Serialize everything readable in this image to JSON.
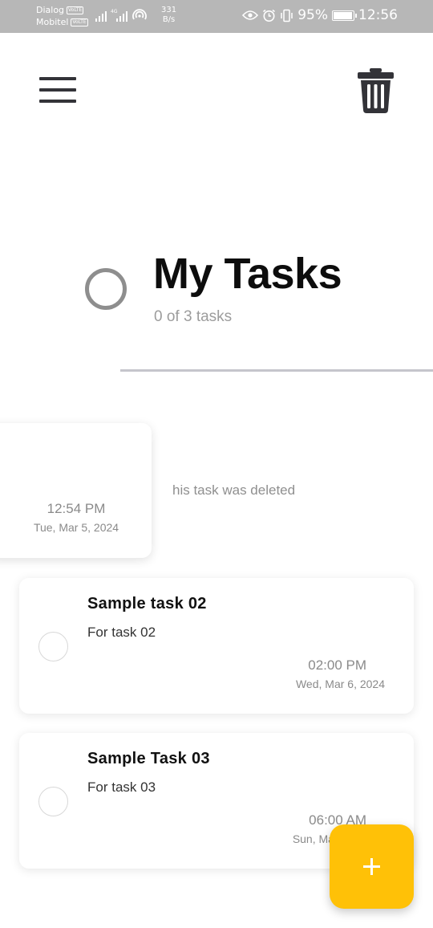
{
  "status_bar": {
    "carrier_1": "Dialog",
    "carrier_2": "Mobitel",
    "volte": "VoLTE",
    "net_speed_value": "331",
    "net_speed_unit": "B/s",
    "battery": "95%",
    "battery_level": 0.95,
    "time": "12:56"
  },
  "header": {
    "menu_icon": "hamburger-menu-icon",
    "delete_icon": "trash-icon",
    "title": "My Tasks",
    "task_count": "0 of 3 tasks"
  },
  "deleted_task": {
    "message": "his task was deleted",
    "time": "12:54 PM",
    "date": "Tue, Mar 5, 2024"
  },
  "tasks": [
    {
      "title": "Sample task 02",
      "description": "For task 02",
      "time": "02:00 PM",
      "date": "Wed, Mar 6, 2024"
    },
    {
      "title": "Sample Task 03",
      "description": "For task 03",
      "time": "06:00 AM",
      "date": "Sun, Mar 10, 2024"
    }
  ],
  "fab": {
    "icon": "plus-icon",
    "color": "#ffc107"
  }
}
